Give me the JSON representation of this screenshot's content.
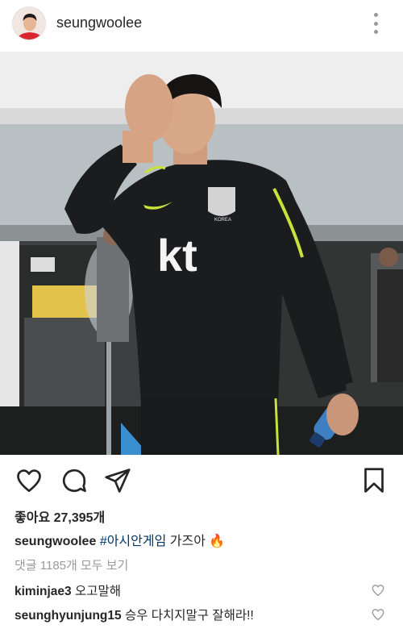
{
  "post": {
    "username": "seungwoolee",
    "likes_text": "좋아요 27,395개",
    "caption_user": "seungwoolee",
    "caption_hashtag": "#아시안게임",
    "caption_text": "가즈아",
    "caption_emoji": "🔥",
    "view_all_comments": "댓글 1185개 모두 보기",
    "photo_logo_text": "kt",
    "photo_badge_text": "KOREA"
  },
  "comments": [
    {
      "user": "kiminjae3",
      "text": "오고말해"
    },
    {
      "user": "seunghyunjung15",
      "text": "승우 다치지말구 잘해라!!"
    }
  ],
  "icons": {
    "like": "heart-icon",
    "comment": "comment-icon",
    "share": "send-icon",
    "save": "bookmark-icon",
    "more": "more-vertical-icon"
  },
  "colors": {
    "hashtag": "#003569",
    "secondary_text": "#999999"
  }
}
